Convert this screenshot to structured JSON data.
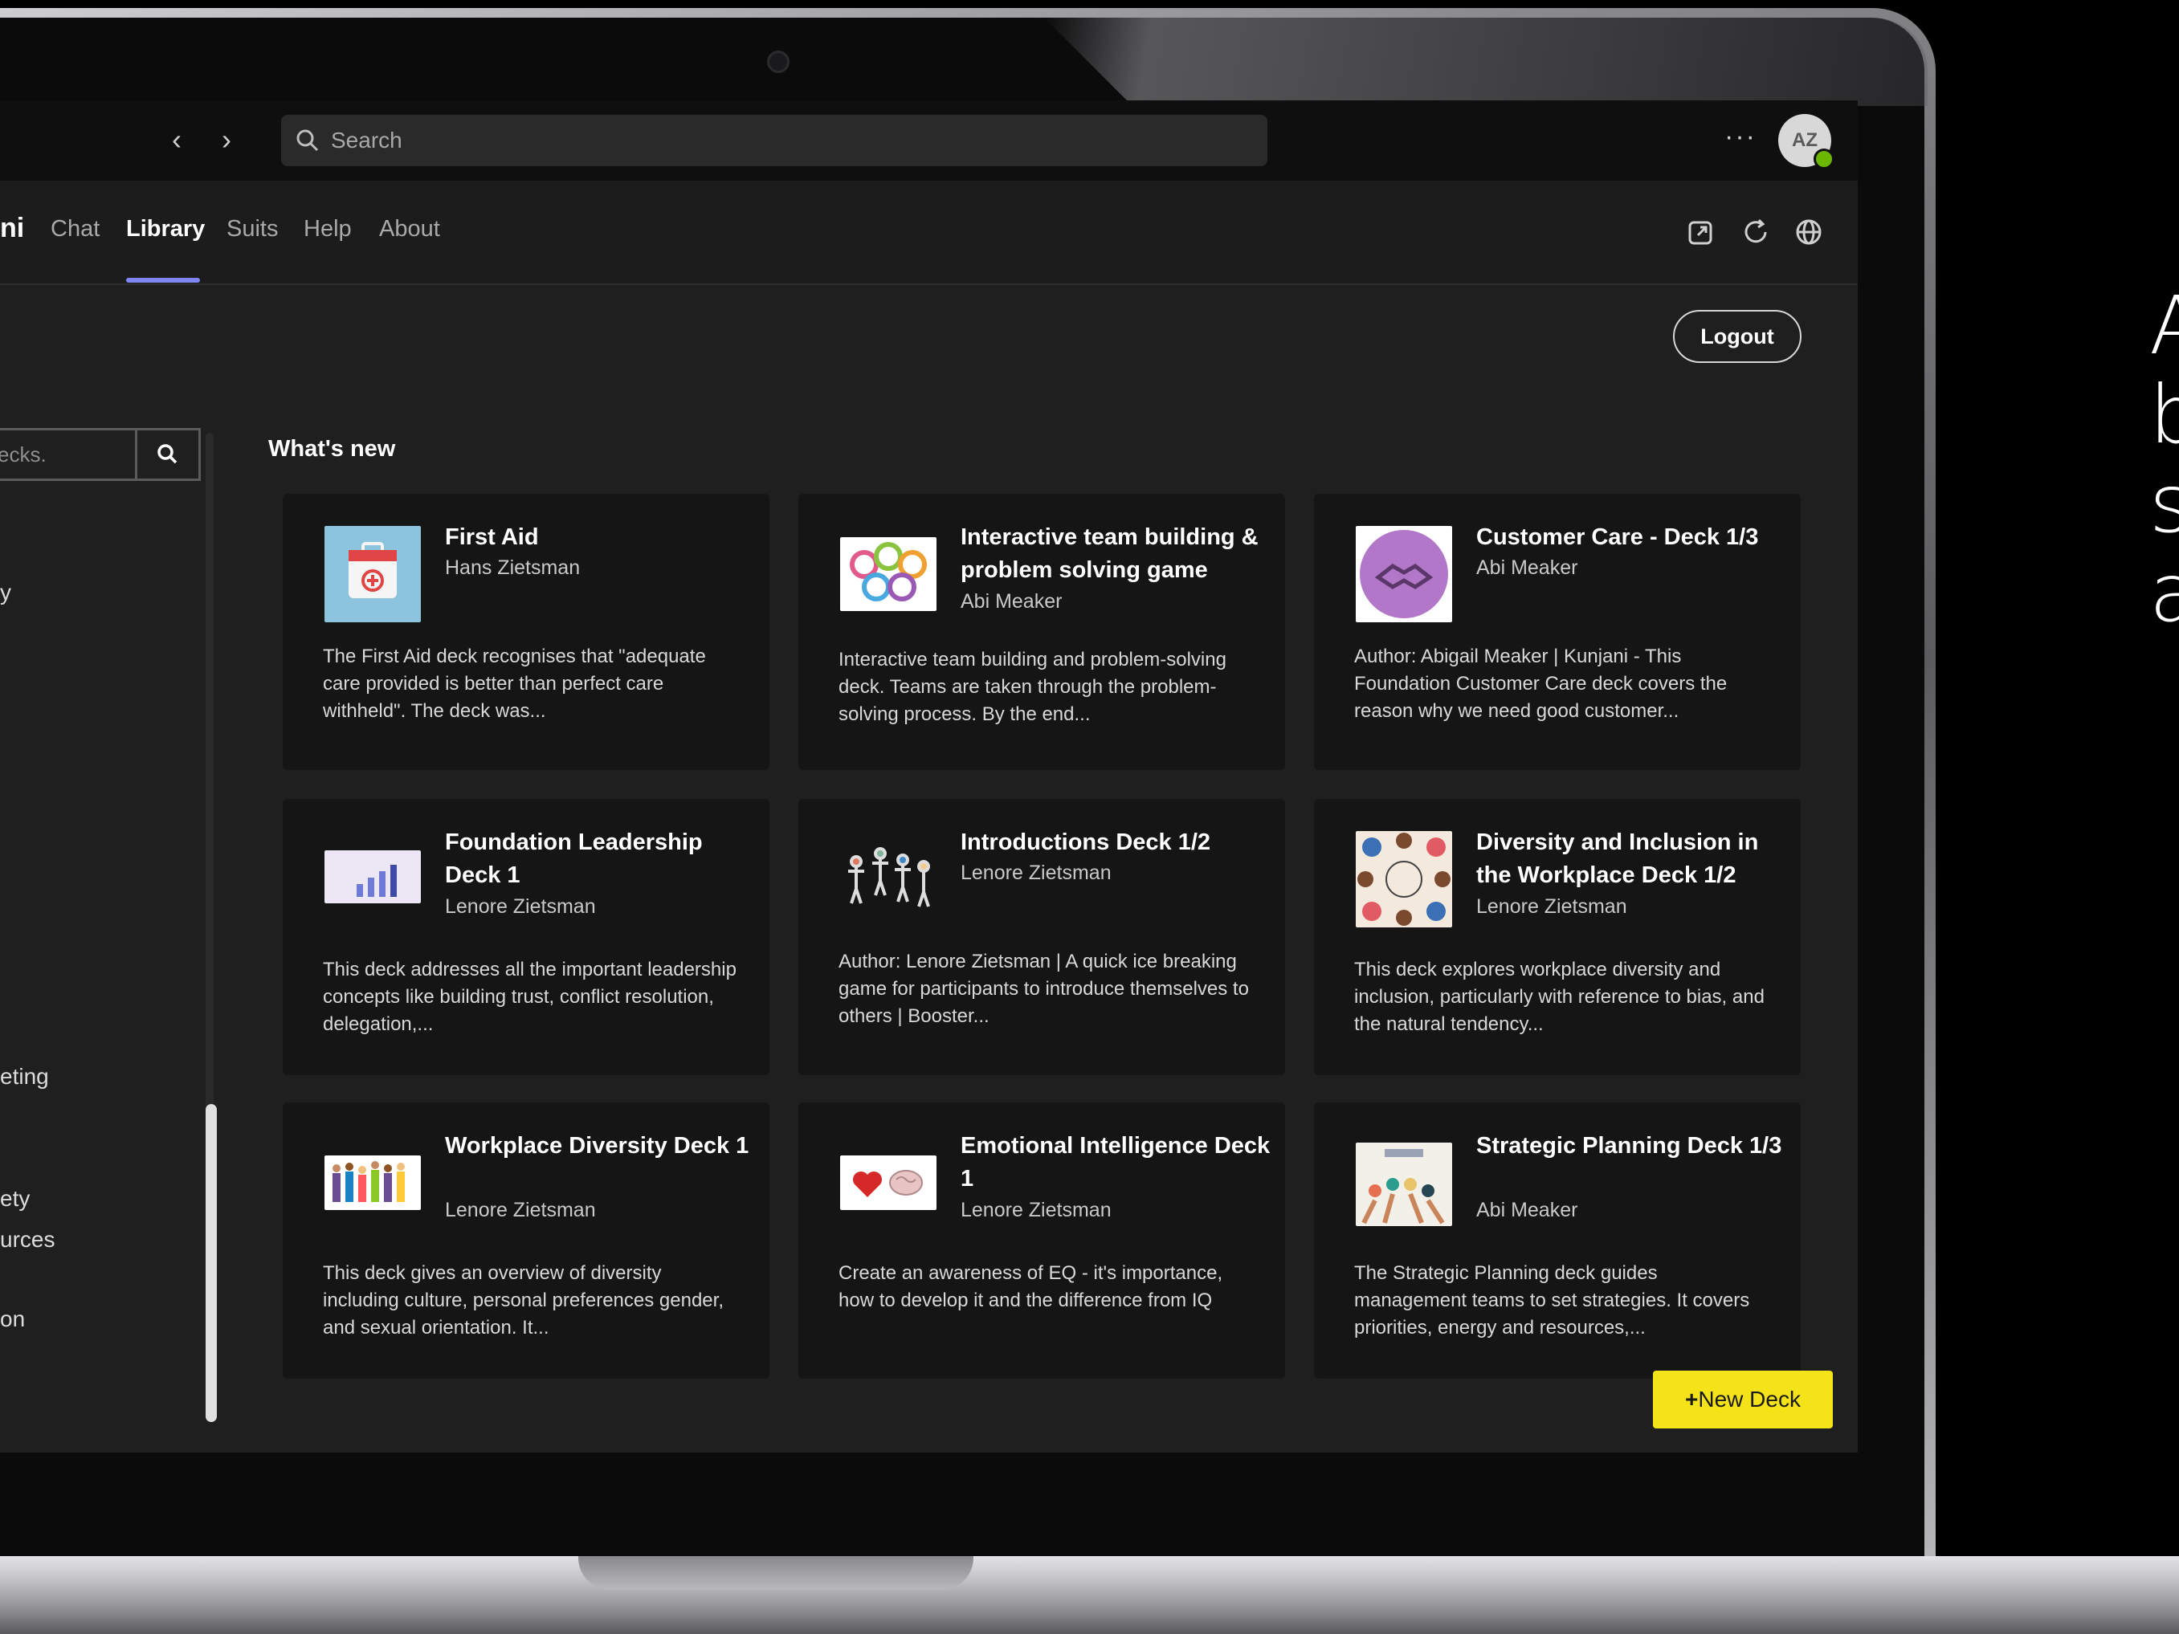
{
  "titlebar": {
    "search_placeholder": "Search",
    "more_label": "···",
    "avatar_initials": "AZ"
  },
  "appbar": {
    "app_name": "ni",
    "tabs": [
      {
        "label": "Chat"
      },
      {
        "label": "Library"
      },
      {
        "label": "Suits"
      },
      {
        "label": "Help"
      },
      {
        "label": "About"
      }
    ],
    "active_tab": "Library",
    "icons": [
      "popout-icon",
      "refresh-icon",
      "globe-icon"
    ]
  },
  "logout_label": "Logout",
  "sidebar": {
    "search_placeholder": "ecks.",
    "items": [
      "y",
      "eting",
      "ety",
      "urces",
      "on"
    ]
  },
  "main": {
    "section_title": "What's new",
    "cards": [
      {
        "title": "First Aid",
        "author": "Hans Zietsman",
        "description": "The First Aid deck recognises that \"adequate care provided is better than perfect care withheld\". The deck was..."
      },
      {
        "title": "Interactive team building & problem solving game",
        "author": "Abi Meaker",
        "description": "Interactive team building and problem-solving deck. Teams are taken through the problem-solving process. By the end..."
      },
      {
        "title": "Customer Care - Deck 1/3",
        "author": "Abi Meaker",
        "description": "Author: Abigail Meaker | Kunjani - This Foundation Customer Care deck covers the reason why we need good customer..."
      },
      {
        "title": "Foundation Leadership Deck 1",
        "author": "Lenore Zietsman",
        "description": "This deck addresses all the important leadership concepts like building trust, conflict resolution, delegation,..."
      },
      {
        "title": "Introductions Deck 1/2",
        "author": "Lenore Zietsman",
        "description": "Author: Lenore Zietsman | A quick ice breaking game for participants to introduce themselves to others | Booster..."
      },
      {
        "title": "Diversity and Inclusion in the Workplace Deck 1/2",
        "author": "Lenore Zietsman",
        "description": "This deck explores workplace diversity and inclusion, particularly with reference to bias, and the natural tendency..."
      },
      {
        "title": "Workplace Diversity Deck 1",
        "author": "Lenore Zietsman",
        "description": "This deck gives an overview of diversity including culture, personal preferences gender, and sexual orientation. It..."
      },
      {
        "title": "Emotional Intelligence Deck 1",
        "author": "Lenore Zietsman",
        "description": "Create an awareness of EQ - it's importance, how to develop it and the difference from IQ"
      },
      {
        "title": "Strategic Planning Deck 1/3",
        "author": "Abi Meaker",
        "description": "The Strategic Planning deck guides management teams to set strategies. It covers priorities, energy and resources,..."
      }
    ],
    "new_deck_label": "New Deck",
    "new_deck_icon": "plus-icon"
  },
  "side_caption_fragments": [
    "A",
    "b",
    "s",
    "a"
  ],
  "colors": {
    "accent": "#7f85f5",
    "new_deck": "#f5e31a",
    "status": "#6bb700"
  }
}
